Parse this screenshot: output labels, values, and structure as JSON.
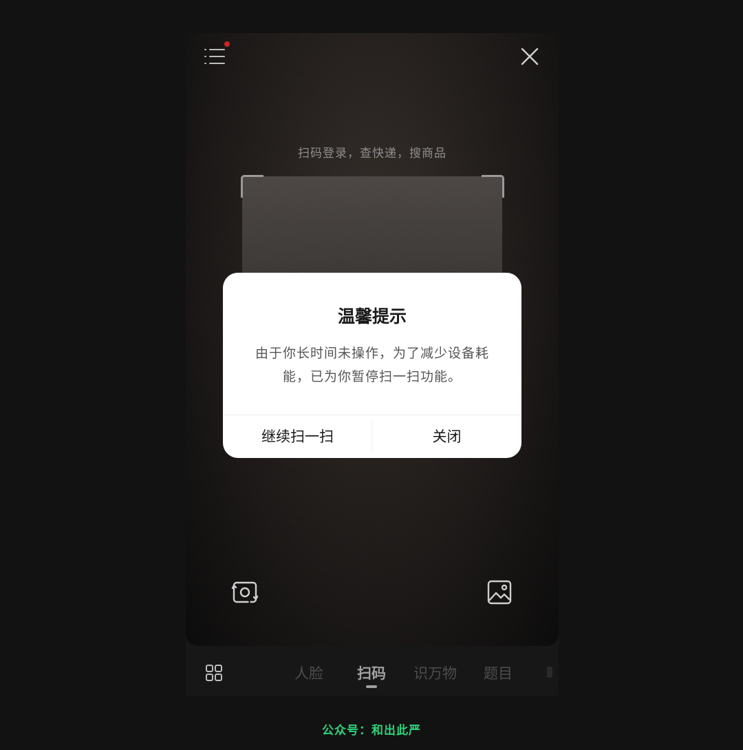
{
  "scanner": {
    "hint": "扫码登录，查快递，搜商品",
    "menu_icon": "list-menu-icon",
    "close_icon": "close-icon",
    "notification_color": "#d22222"
  },
  "dialog": {
    "title": "温馨提示",
    "message": "由于你长时间未操作，为了减少设备耗能，已为你暂停扫一扫功能。",
    "continue_label": "继续扫一扫",
    "close_label": "关闭"
  },
  "bottom_icons": {
    "left": "flip-camera-icon",
    "right": "gallery-icon"
  },
  "tabs": {
    "grid_icon": "grid-icon",
    "items": [
      {
        "label": "人脸"
      },
      {
        "label": "扫码",
        "active": true
      },
      {
        "label": "识万物"
      },
      {
        "label": "题目"
      }
    ]
  },
  "watermark": "公众号：和出此严"
}
